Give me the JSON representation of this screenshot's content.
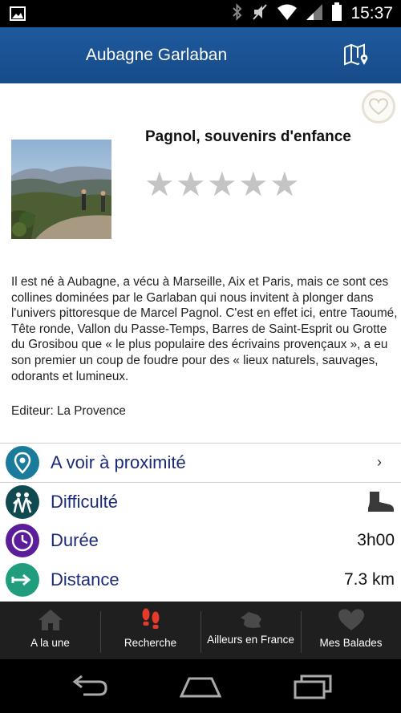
{
  "status_bar": {
    "time": "15:37",
    "icons": [
      "image-icon",
      "bluetooth-icon",
      "mute-icon",
      "wifi-icon",
      "signal-icon",
      "battery-icon"
    ]
  },
  "app_bar": {
    "title": "Aubagne Garlaban",
    "map_icon": "map-pin-icon"
  },
  "walk": {
    "title": "Pagnol, souvenirs d'enfance",
    "rating": 0,
    "rating_max": 5,
    "description": "Il est né à Aubagne, a vécu à Marseille, Aix et Paris, mais ce sont ces collines dominées par le Garlaban qui nous invitent à plonger dans l'univers pittoresque de Marcel Pagnol. C'est en effet ici, entre Taoumé, Tête ronde, Vallon du Passe-Temps, Barres de Saint-Esprit ou Grotte du Grosibou que « le plus populaire des écrivains provençaux », a eu son premier un coup de foudre pour des « lieux naturels, sauvages, odorants et lumineux.",
    "editor": "Editeur: La Provence"
  },
  "rows": [
    {
      "label": "A voir à proximité",
      "icon": "location-pin-icon",
      "color": "#1b7b9a",
      "chevron": "›"
    },
    {
      "label": "Difficulté",
      "icon": "hikers-icon",
      "color": "#0e4a50",
      "value_icon": "boot-icon"
    },
    {
      "label": "Durée",
      "icon": "clock-icon",
      "color": "#5b1d9a",
      "value": "3h00"
    },
    {
      "label": "Distance",
      "icon": "arrow-icon",
      "color": "#1f9d7d",
      "value": "7.3 km"
    }
  ],
  "tabs": [
    {
      "label": "A la une",
      "icon": "home-icon"
    },
    {
      "label": "Recherche",
      "icon": "footprints-icon",
      "accent": "#e53b2c"
    },
    {
      "label": "Ailleurs en France",
      "icon": "france-map-icon"
    },
    {
      "label": "Mes Balades",
      "icon": "heart-icon"
    }
  ],
  "colors": {
    "app_bar": "#1a5292",
    "row_label": "#1c2a7a",
    "tab_bar": "#1f1f1f"
  }
}
